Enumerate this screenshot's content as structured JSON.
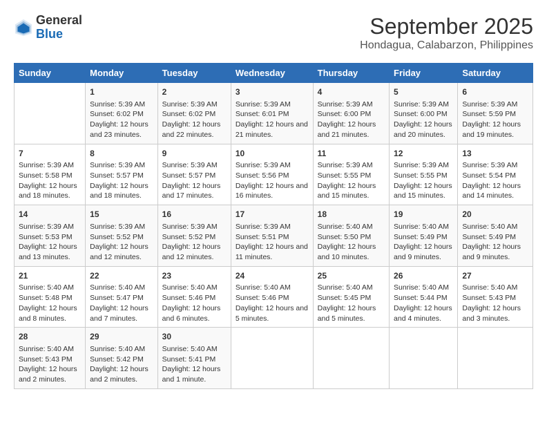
{
  "header": {
    "logo_line1": "General",
    "logo_line2": "Blue",
    "title": "September 2025",
    "subtitle": "Hondagua, Calabarzon, Philippines"
  },
  "columns": [
    "Sunday",
    "Monday",
    "Tuesday",
    "Wednesday",
    "Thursday",
    "Friday",
    "Saturday"
  ],
  "weeks": [
    [
      {
        "day": "",
        "sunrise": "",
        "sunset": "",
        "daylight": ""
      },
      {
        "day": "1",
        "sunrise": "Sunrise: 5:39 AM",
        "sunset": "Sunset: 6:02 PM",
        "daylight": "Daylight: 12 hours and 23 minutes."
      },
      {
        "day": "2",
        "sunrise": "Sunrise: 5:39 AM",
        "sunset": "Sunset: 6:02 PM",
        "daylight": "Daylight: 12 hours and 22 minutes."
      },
      {
        "day": "3",
        "sunrise": "Sunrise: 5:39 AM",
        "sunset": "Sunset: 6:01 PM",
        "daylight": "Daylight: 12 hours and 21 minutes."
      },
      {
        "day": "4",
        "sunrise": "Sunrise: 5:39 AM",
        "sunset": "Sunset: 6:00 PM",
        "daylight": "Daylight: 12 hours and 21 minutes."
      },
      {
        "day": "5",
        "sunrise": "Sunrise: 5:39 AM",
        "sunset": "Sunset: 6:00 PM",
        "daylight": "Daylight: 12 hours and 20 minutes."
      },
      {
        "day": "6",
        "sunrise": "Sunrise: 5:39 AM",
        "sunset": "Sunset: 5:59 PM",
        "daylight": "Daylight: 12 hours and 19 minutes."
      }
    ],
    [
      {
        "day": "7",
        "sunrise": "Sunrise: 5:39 AM",
        "sunset": "Sunset: 5:58 PM",
        "daylight": "Daylight: 12 hours and 18 minutes."
      },
      {
        "day": "8",
        "sunrise": "Sunrise: 5:39 AM",
        "sunset": "Sunset: 5:57 PM",
        "daylight": "Daylight: 12 hours and 18 minutes."
      },
      {
        "day": "9",
        "sunrise": "Sunrise: 5:39 AM",
        "sunset": "Sunset: 5:57 PM",
        "daylight": "Daylight: 12 hours and 17 minutes."
      },
      {
        "day": "10",
        "sunrise": "Sunrise: 5:39 AM",
        "sunset": "Sunset: 5:56 PM",
        "daylight": "Daylight: 12 hours and 16 minutes."
      },
      {
        "day": "11",
        "sunrise": "Sunrise: 5:39 AM",
        "sunset": "Sunset: 5:55 PM",
        "daylight": "Daylight: 12 hours and 15 minutes."
      },
      {
        "day": "12",
        "sunrise": "Sunrise: 5:39 AM",
        "sunset": "Sunset: 5:55 PM",
        "daylight": "Daylight: 12 hours and 15 minutes."
      },
      {
        "day": "13",
        "sunrise": "Sunrise: 5:39 AM",
        "sunset": "Sunset: 5:54 PM",
        "daylight": "Daylight: 12 hours and 14 minutes."
      }
    ],
    [
      {
        "day": "14",
        "sunrise": "Sunrise: 5:39 AM",
        "sunset": "Sunset: 5:53 PM",
        "daylight": "Daylight: 12 hours and 13 minutes."
      },
      {
        "day": "15",
        "sunrise": "Sunrise: 5:39 AM",
        "sunset": "Sunset: 5:52 PM",
        "daylight": "Daylight: 12 hours and 12 minutes."
      },
      {
        "day": "16",
        "sunrise": "Sunrise: 5:39 AM",
        "sunset": "Sunset: 5:52 PM",
        "daylight": "Daylight: 12 hours and 12 minutes."
      },
      {
        "day": "17",
        "sunrise": "Sunrise: 5:39 AM",
        "sunset": "Sunset: 5:51 PM",
        "daylight": "Daylight: 12 hours and 11 minutes."
      },
      {
        "day": "18",
        "sunrise": "Sunrise: 5:40 AM",
        "sunset": "Sunset: 5:50 PM",
        "daylight": "Daylight: 12 hours and 10 minutes."
      },
      {
        "day": "19",
        "sunrise": "Sunrise: 5:40 AM",
        "sunset": "Sunset: 5:49 PM",
        "daylight": "Daylight: 12 hours and 9 minutes."
      },
      {
        "day": "20",
        "sunrise": "Sunrise: 5:40 AM",
        "sunset": "Sunset: 5:49 PM",
        "daylight": "Daylight: 12 hours and 9 minutes."
      }
    ],
    [
      {
        "day": "21",
        "sunrise": "Sunrise: 5:40 AM",
        "sunset": "Sunset: 5:48 PM",
        "daylight": "Daylight: 12 hours and 8 minutes."
      },
      {
        "day": "22",
        "sunrise": "Sunrise: 5:40 AM",
        "sunset": "Sunset: 5:47 PM",
        "daylight": "Daylight: 12 hours and 7 minutes."
      },
      {
        "day": "23",
        "sunrise": "Sunrise: 5:40 AM",
        "sunset": "Sunset: 5:46 PM",
        "daylight": "Daylight: 12 hours and 6 minutes."
      },
      {
        "day": "24",
        "sunrise": "Sunrise: 5:40 AM",
        "sunset": "Sunset: 5:46 PM",
        "daylight": "Daylight: 12 hours and 5 minutes."
      },
      {
        "day": "25",
        "sunrise": "Sunrise: 5:40 AM",
        "sunset": "Sunset: 5:45 PM",
        "daylight": "Daylight: 12 hours and 5 minutes."
      },
      {
        "day": "26",
        "sunrise": "Sunrise: 5:40 AM",
        "sunset": "Sunset: 5:44 PM",
        "daylight": "Daylight: 12 hours and 4 minutes."
      },
      {
        "day": "27",
        "sunrise": "Sunrise: 5:40 AM",
        "sunset": "Sunset: 5:43 PM",
        "daylight": "Daylight: 12 hours and 3 minutes."
      }
    ],
    [
      {
        "day": "28",
        "sunrise": "Sunrise: 5:40 AM",
        "sunset": "Sunset: 5:43 PM",
        "daylight": "Daylight: 12 hours and 2 minutes."
      },
      {
        "day": "29",
        "sunrise": "Sunrise: 5:40 AM",
        "sunset": "Sunset: 5:42 PM",
        "daylight": "Daylight: 12 hours and 2 minutes."
      },
      {
        "day": "30",
        "sunrise": "Sunrise: 5:40 AM",
        "sunset": "Sunset: 5:41 PM",
        "daylight": "Daylight: 12 hours and 1 minute."
      },
      {
        "day": "",
        "sunrise": "",
        "sunset": "",
        "daylight": ""
      },
      {
        "day": "",
        "sunrise": "",
        "sunset": "",
        "daylight": ""
      },
      {
        "day": "",
        "sunrise": "",
        "sunset": "",
        "daylight": ""
      },
      {
        "day": "",
        "sunrise": "",
        "sunset": "",
        "daylight": ""
      }
    ]
  ]
}
